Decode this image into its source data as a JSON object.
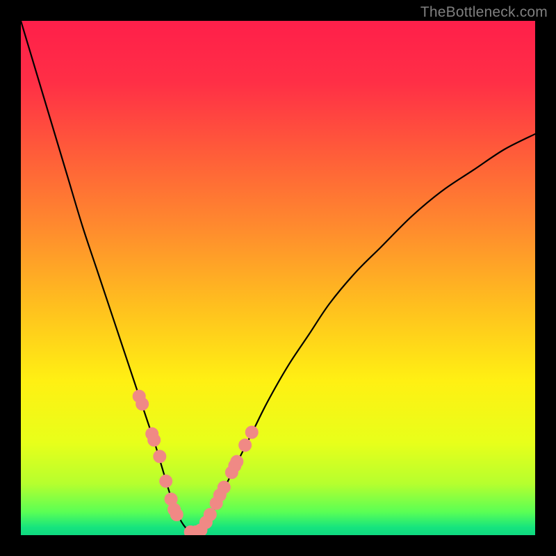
{
  "watermark": "TheBottleneck.com",
  "colors": {
    "frame": "#000000",
    "watermark": "#7f7f7f",
    "curve_stroke": "#000000",
    "marker_fill": "#f08985",
    "marker_stroke": "#f08985",
    "gradient_stops": [
      {
        "offset": 0.0,
        "color": "#ff1f4a"
      },
      {
        "offset": 0.12,
        "color": "#ff2f46"
      },
      {
        "offset": 0.25,
        "color": "#ff5a3a"
      },
      {
        "offset": 0.4,
        "color": "#ff8a2e"
      },
      {
        "offset": 0.55,
        "color": "#ffbe1f"
      },
      {
        "offset": 0.7,
        "color": "#fff013"
      },
      {
        "offset": 0.82,
        "color": "#e8ff1a"
      },
      {
        "offset": 0.9,
        "color": "#b6ff2e"
      },
      {
        "offset": 0.955,
        "color": "#5aff55"
      },
      {
        "offset": 0.985,
        "color": "#16e47e"
      },
      {
        "offset": 1.0,
        "color": "#0fd880"
      }
    ]
  },
  "chart_data": {
    "type": "line",
    "title": "",
    "xlabel": "",
    "ylabel": "",
    "xlim": [
      0,
      100
    ],
    "ylim": [
      0,
      100
    ],
    "grid": false,
    "series": [
      {
        "name": "bottleneck-curve",
        "x": [
          0,
          3,
          6,
          9,
          12,
          15,
          18,
          20,
          22,
          24,
          26,
          27.5,
          29,
          30.5,
          32,
          33.5,
          35,
          37,
          39,
          42,
          45,
          48,
          52,
          56,
          60,
          65,
          70,
          76,
          82,
          88,
          94,
          100
        ],
        "y": [
          100,
          90,
          80,
          70,
          60,
          51,
          42,
          36,
          30,
          24,
          18,
          13,
          8,
          4,
          1.5,
          0.5,
          1.5,
          4,
          8,
          14,
          20,
          26,
          33,
          39,
          45,
          51,
          56,
          62,
          67,
          71,
          75,
          78
        ]
      }
    ],
    "markers": {
      "name": "highlight-points",
      "x": [
        23.0,
        23.6,
        25.5,
        25.9,
        27.0,
        28.2,
        29.2,
        29.8,
        30.3,
        33.0,
        34.0,
        35.0,
        36.0,
        36.8,
        38.0,
        38.7,
        39.5,
        41.0,
        41.6,
        42.0,
        43.6,
        44.9
      ],
      "y": [
        27.0,
        25.5,
        19.7,
        18.5,
        15.3,
        10.5,
        7.0,
        5.0,
        4.0,
        0.6,
        0.6,
        1.0,
        2.5,
        4.0,
        6.2,
        7.8,
        9.3,
        12.2,
        13.5,
        14.3,
        17.5,
        20.0
      ]
    }
  }
}
